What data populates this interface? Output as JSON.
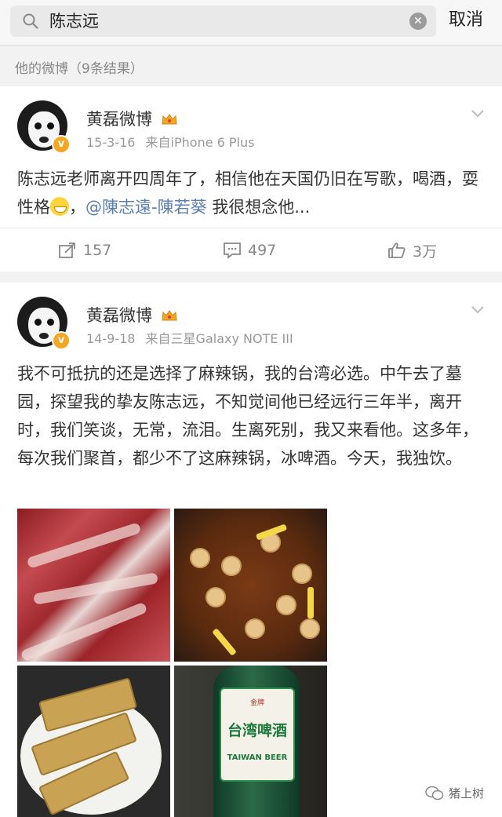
{
  "search": {
    "query": "陈志远",
    "cancel_label": "取消"
  },
  "results_header": "他的微博（9条结果）",
  "posts": [
    {
      "username": "黄磊微博",
      "date": "15-3-16",
      "source": "来自iPhone 6 Plus",
      "text_a": "陈志远老师离开四周年了，相信他在天国仍旧在写歌，喝酒，耍性格",
      "text_b": "，",
      "mention": "@陳志遠-陳若葵",
      "text_c": " 我很想念他...",
      "reposts": "157",
      "comments": "497",
      "likes": "3万"
    },
    {
      "username": "黄磊微博",
      "date": "14-9-18",
      "source": "来自三星Galaxy NOTE III",
      "text": "我不可抵抗的还是选择了麻辣锅，我的台湾必选。中午去了墓园，探望我的挚友陈志远，不知觉间他已经远行三年半，离开时，我们笑谈，无常，流泪。生离死别，我又来看他。这多年，每次我们聚首，都少不了这麻辣锅，冰啤酒。今天，我独饮。",
      "beer_label": "台湾啤酒",
      "beer_label_en": "TAIWAN BEER",
      "beer_label_top": "金牌"
    }
  ],
  "watermark": "猪上树",
  "colors": {
    "mention": "#5b7fb3",
    "badge": "#f5a623"
  }
}
